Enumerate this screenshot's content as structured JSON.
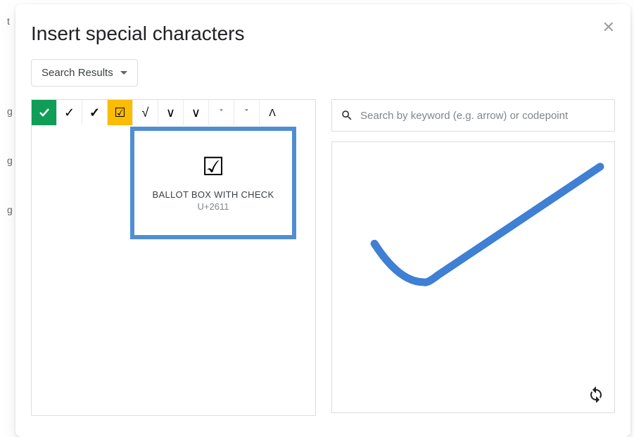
{
  "bg": {
    "t1": "t",
    "t2": "g",
    "t3": "g",
    "t4": "g"
  },
  "header": {
    "title": "Insert special characters"
  },
  "filter": {
    "label": "Search Results"
  },
  "results": {
    "chars": [
      "✓",
      "✓",
      "✓",
      "☑",
      "√",
      "∨",
      "∨",
      "ˇ",
      "ˇ",
      "ꓥ"
    ],
    "selected_index": 3
  },
  "tooltip": {
    "glyph": "☑",
    "name": "BALLOT BOX WITH CHECK",
    "code": "U+2611"
  },
  "search": {
    "placeholder": "Search by keyword (e.g. arrow) or codepoint",
    "value": ""
  }
}
